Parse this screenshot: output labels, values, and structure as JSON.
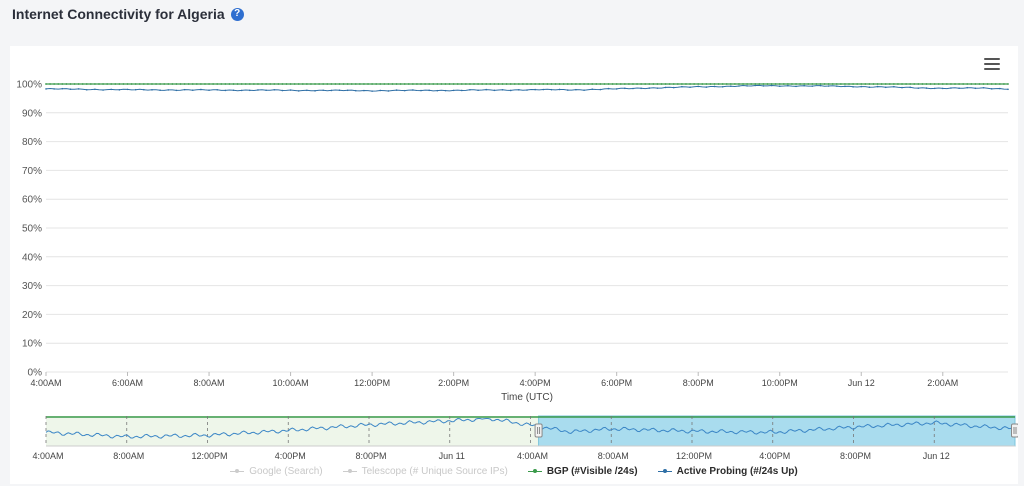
{
  "page": {
    "title": "Internet Connectivity for Algeria",
    "help_icon": "?"
  },
  "colors": {
    "bgp": "#3a9a4b",
    "active_probing": "#2f6fa6",
    "navigator_series": "#3b86c6",
    "navigator_selection": "#a9dcee",
    "navigator_left_bg": "#eef6ea",
    "grid": "#e4e4e4",
    "disabled": "#cccccc"
  },
  "icons": {
    "menu": "hamburger-menu-icon",
    "help": "question-circle-icon"
  },
  "chart_data": {
    "type": "line",
    "xlabel": "Time (UTC)",
    "ylabel": "",
    "ylim": [
      0,
      100
    ],
    "y_ticks": [
      "0%",
      "10%",
      "20%",
      "30%",
      "40%",
      "50%",
      "60%",
      "70%",
      "80%",
      "90%",
      "100%"
    ],
    "x_ticks": [
      "4:00AM",
      "6:00AM",
      "8:00AM",
      "10:00AM",
      "12:00PM",
      "2:00PM",
      "4:00PM",
      "6:00PM",
      "8:00PM",
      "10:00PM",
      "Jun 12",
      "2:00AM"
    ],
    "x_range_hours": [
      0,
      23.6
    ],
    "grid": true,
    "legend_position": "bottom",
    "series": [
      {
        "name": "BGP (#Visible /24s)",
        "enabled": true,
        "values_constant": 100
      },
      {
        "name": "Active Probing (#/24s Up)",
        "enabled": true,
        "keyframes": [
          [
            0,
            98.3
          ],
          [
            2,
            98.0
          ],
          [
            4,
            97.9
          ],
          [
            6,
            97.8
          ],
          [
            8,
            97.7
          ],
          [
            10,
            97.8
          ],
          [
            12,
            98.0
          ],
          [
            13,
            98.0
          ],
          [
            14,
            98.3
          ],
          [
            15,
            98.7
          ],
          [
            16,
            99.0
          ],
          [
            17,
            99.3
          ],
          [
            18,
            99.4
          ],
          [
            19,
            99.3
          ],
          [
            20,
            99.1
          ],
          [
            21,
            98.8
          ],
          [
            22,
            98.5
          ],
          [
            23,
            98.6
          ],
          [
            23.6,
            98.3
          ]
        ]
      },
      {
        "name": "Google (Search)",
        "enabled": false
      },
      {
        "name": "Telescope (# Unique Source IPs)",
        "enabled": false
      }
    ],
    "navigator": {
      "x_ticks": [
        "4:00AM",
        "8:00AM",
        "12:00PM",
        "4:00PM",
        "8:00PM",
        "Jun 11",
        "4:00AM",
        "8:00AM",
        "12:00PM",
        "4:00PM",
        "8:00PM",
        "Jun 12"
      ],
      "x_range_hours": [
        0,
        48
      ],
      "selection_hours": [
        24.4,
        48
      ],
      "profile": [
        [
          0,
          0.4
        ],
        [
          4,
          0.22
        ],
        [
          8,
          0.28
        ],
        [
          12,
          0.48
        ],
        [
          16,
          0.72
        ],
        [
          20,
          0.88
        ],
        [
          22,
          0.98
        ],
        [
          24,
          0.7
        ],
        [
          26,
          0.42
        ],
        [
          28,
          0.55
        ],
        [
          32,
          0.45
        ],
        [
          36,
          0.4
        ],
        [
          40,
          0.62
        ],
        [
          44,
          0.8
        ],
        [
          46,
          0.66
        ],
        [
          48,
          0.55
        ]
      ]
    }
  },
  "legend": [
    {
      "label": "Google (Search)",
      "enabled": false
    },
    {
      "label": "Telescope (# Unique Source IPs)",
      "enabled": false
    },
    {
      "label": "BGP (#Visible /24s)",
      "enabled": true,
      "color": "#3a9a4b"
    },
    {
      "label": "Active Probing (#/24s Up)",
      "enabled": true,
      "color": "#2f6fa6"
    }
  ]
}
